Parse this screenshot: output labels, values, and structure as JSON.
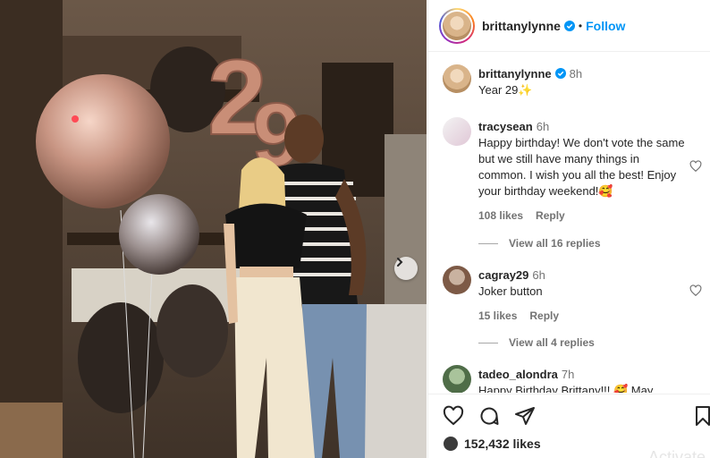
{
  "post": {
    "author": "brittanylynne",
    "follow_label": "Follow",
    "separator": "•",
    "caption_user": "brittanylynne",
    "caption_time": "8h",
    "caption_text": "Year 29✨"
  },
  "comments": [
    {
      "user": "tracysean",
      "time": "6h",
      "text": "Happy birthday! We don't vote the same but we still have many things in common. I wish you all the best! Enjoy your birthday weekend!🥰",
      "likes": "108 likes",
      "reply_label": "Reply",
      "view_replies": "View all 16 replies"
    },
    {
      "user": "cagray29",
      "time": "6h",
      "text": "Joker button",
      "likes": "15 likes",
      "reply_label": "Reply",
      "view_replies": "View all 4 replies"
    },
    {
      "user": "tadeo_alondra",
      "time": "7h",
      "text": "Happy Birthday Brittany!!! 🥰 May"
    }
  ],
  "footer": {
    "likes_count": "152,432 likes",
    "watermark": "Activate Wi"
  },
  "icons": {
    "heart": "heart-icon",
    "comment": "comment-icon",
    "share": "share-icon",
    "save": "bookmark-icon",
    "next": "chevron-right-icon"
  },
  "colors": {
    "follow": "#0095f6",
    "verified": "#0095f6",
    "muted": "#737373"
  }
}
